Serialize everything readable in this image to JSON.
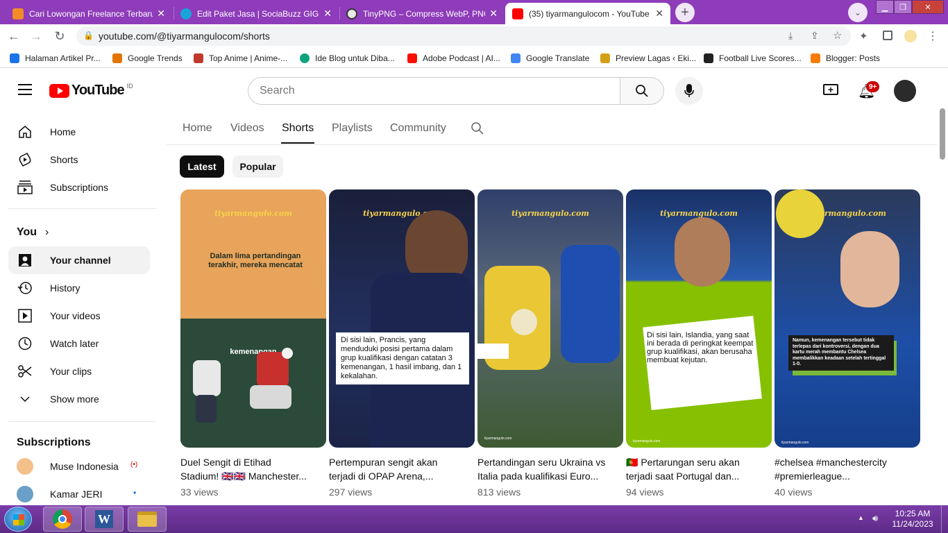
{
  "browser": {
    "tabs": [
      {
        "title": "Cari Lowongan Freelance Terbaru",
        "favicon_color": "#f28c28"
      },
      {
        "title": "Edit Paket Jasa | SociaBuzz GIGS",
        "favicon_color": "#1aa3d9"
      },
      {
        "title": "TinyPNG – Compress WebP, PNG",
        "favicon_color": "#6f6f6f"
      },
      {
        "title": "(35) tiyarmangulocom - YouTube",
        "favicon_color": "#ff0000"
      }
    ],
    "new_tab_label": "+",
    "url": "youtube.com/@tiyarmangulocom/shorts",
    "bookmarks": [
      {
        "label": "Halaman Artikel Pr...",
        "color": "#1a73e8"
      },
      {
        "label": "Google Trends",
        "color": "#e37400"
      },
      {
        "label": "Top Anime | Anime-...",
        "color": "#c0392b"
      },
      {
        "label": "Ide Blog untuk Diba...",
        "color": "#10a37f"
      },
      {
        "label": "Adobe Podcast | AI...",
        "color": "#fa0f00"
      },
      {
        "label": "Google Translate",
        "color": "#4285f4"
      },
      {
        "label": "Preview Lagas ‹ Eki...",
        "color": "#d4a017"
      },
      {
        "label": "Football Live Scores...",
        "color": "#222222"
      },
      {
        "label": "Blogger: Posts",
        "color": "#f57c00"
      }
    ]
  },
  "youtube": {
    "logo_text": "YouTube",
    "logo_region": "ID",
    "search_placeholder": "Search",
    "notification_count": "9+",
    "sidebar": {
      "main": [
        {
          "label": "Home",
          "icon": "home-icon"
        },
        {
          "label": "Shorts",
          "icon": "shorts-icon"
        },
        {
          "label": "Subscriptions",
          "icon": "subscriptions-icon"
        }
      ],
      "you_heading": "You",
      "you_items": [
        {
          "label": "Your channel",
          "icon": "channel-icon",
          "selected": true
        },
        {
          "label": "History",
          "icon": "history-icon"
        },
        {
          "label": "Your videos",
          "icon": "videos-icon"
        },
        {
          "label": "Watch later",
          "icon": "clock-icon"
        },
        {
          "label": "Your clips",
          "icon": "scissors-icon"
        },
        {
          "label": "Show more",
          "icon": "chevron-down-icon"
        }
      ],
      "subscriptions_heading": "Subscriptions",
      "subscriptions": [
        {
          "label": "Muse Indonesia",
          "status": "(•)",
          "status_color": "#cc0000"
        },
        {
          "label": "Kamar JERI",
          "status": "•",
          "status_color": "#065fd4"
        }
      ]
    },
    "channel_tabs": [
      "Home",
      "Videos",
      "Shorts",
      "Playlists",
      "Community"
    ],
    "selected_tab": "Shorts",
    "chips": [
      "Latest",
      "Popular"
    ],
    "shorts": [
      {
        "title_line1": "Duel Sengit di Etihad",
        "title_line2": "Stadium! 🇬🇧🇬🇧 Manchester...",
        "views": "33 views",
        "watermark": "tiyarmangulo.com",
        "caption_top": "Dalam lima pertandingan terakhir, mereka mencatat",
        "caption_bottom": "kemenangan"
      },
      {
        "title_line1": "Pertempuran sengit akan",
        "title_line2": "terjadi di OPAP Arena,...",
        "views": "297 views",
        "watermark": "tiyarmangulo.com",
        "caption": "Di sisi lain, Prancis, yang menduduki posisi pertama dalam grup kualifikasi dengan catatan 3 kemenangan, 1 hasil imbang, dan 1 kekalahan."
      },
      {
        "title_line1": "Pertandingan seru Ukraina vs",
        "title_line2": "Italia pada kualifikasi Euro...",
        "views": "813 views",
        "watermark": "tiyarmangulo.com"
      },
      {
        "title_line1": "🇵🇹 Pertarungan seru akan",
        "title_line2": "terjadi saat Portugal dan...",
        "views": "94 views",
        "watermark": "tiyarmangulo.com",
        "caption": "Di sisi lain, Islandia, yang saat ini berada di peringkat keempat grup kualifikasi, akan berusaha membuat kejutan."
      },
      {
        "title_line1": "#chelsea #manchestercity",
        "title_line2": "#premierleague...",
        "views": "40 views",
        "watermark": "tiyarmangulo.com",
        "caption": "Namun, kemenangan tersebut tidak terlepas dari kontroversi, dengan dua kartu merah membantu Chelsea membalikkan keadaan setelah tertinggal 1-0."
      }
    ],
    "card_footer": "tiyarmangulo.com"
  },
  "taskbar": {
    "time": "10:25 AM",
    "date": "11/24/2023"
  }
}
